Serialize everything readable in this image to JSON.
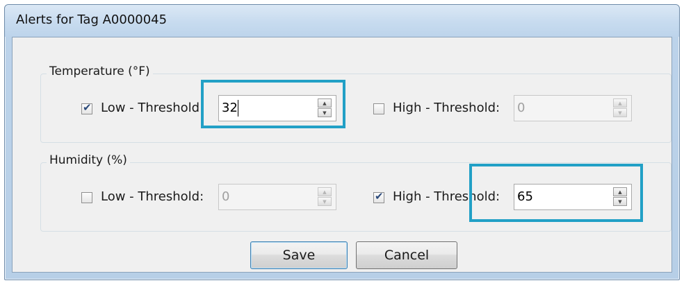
{
  "window": {
    "title": "Alerts for Tag A0000045"
  },
  "temperature": {
    "group_label": "Temperature (°F)",
    "low": {
      "checked": true,
      "label": "Low - Threshold:",
      "value": "32",
      "enabled": true
    },
    "high": {
      "checked": false,
      "label": "High - Threshold:",
      "value": "0",
      "enabled": false
    }
  },
  "humidity": {
    "group_label": "Humidity (%)",
    "low": {
      "checked": false,
      "label": "Low - Threshold:",
      "value": "0",
      "enabled": false
    },
    "high": {
      "checked": true,
      "label": "High - Threshold:",
      "value": "65",
      "enabled": true
    }
  },
  "buttons": {
    "save_label": "Save",
    "cancel_label": "Cancel"
  },
  "icons": {
    "check": "checkmark-icon",
    "up": "spin-up-icon",
    "down": "spin-down-icon"
  },
  "colors": {
    "highlight": "#22a0c6",
    "titlebar": "#c7dbef"
  }
}
